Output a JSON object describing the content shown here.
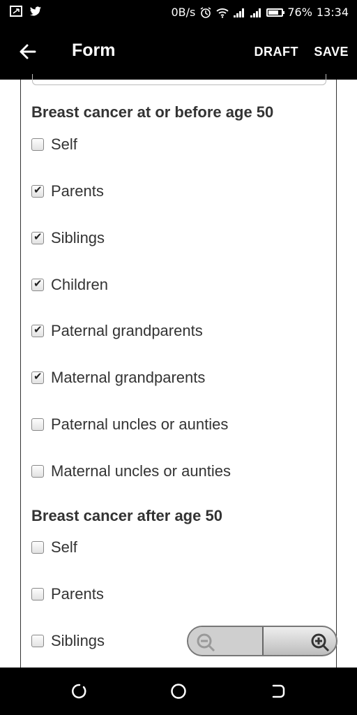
{
  "status_bar": {
    "speed": "0B/s",
    "battery_percent": "76%",
    "battery_level": 0.76,
    "time": "13:34",
    "icons": [
      "screenshot-icon",
      "twitter-icon",
      "alarm-icon",
      "wifi-icon",
      "signal-icon",
      "signal-icon",
      "battery-icon"
    ]
  },
  "app_bar": {
    "title": "Form",
    "draft_label": "DRAFT",
    "save_label": "SAVE"
  },
  "sections": [
    {
      "title": "Breast cancer at or before age 50",
      "options": [
        {
          "label": "Self",
          "checked": false
        },
        {
          "label": "Parents",
          "checked": true
        },
        {
          "label": "Siblings",
          "checked": true
        },
        {
          "label": "Children",
          "checked": true
        },
        {
          "label": "Paternal grandparents",
          "checked": true
        },
        {
          "label": "Maternal grandparents",
          "checked": true
        },
        {
          "label": "Paternal uncles or aunties",
          "checked": false
        },
        {
          "label": "Maternal uncles or aunties",
          "checked": false
        }
      ]
    },
    {
      "title": "Breast cancer after age 50",
      "options": [
        {
          "label": "Self",
          "checked": false
        },
        {
          "label": "Parents",
          "checked": false
        },
        {
          "label": "Siblings",
          "checked": false
        }
      ]
    }
  ],
  "zoom": {
    "out_icon": "zoom-out-icon",
    "in_icon": "zoom-in-icon"
  },
  "nav_bar": {
    "icons": [
      "recent-apps-icon",
      "home-icon",
      "back-nav-icon"
    ]
  }
}
